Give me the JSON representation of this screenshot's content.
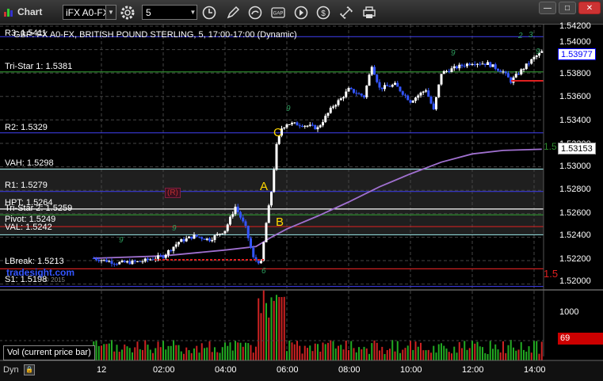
{
  "window": {
    "title": "Chart",
    "symbol": "іFX A0-FX",
    "interval": "5",
    "caption": "GBP: FX A0-FX, BRITISH POUND STERLING, 5, 17:00-17:00 (Dynamic)",
    "watermark": "tradesight.com",
    "watermark_sub": "© 2015"
  },
  "price_axis": {
    "labels": [
      "1.54200",
      "1.54000",
      "1.53800",
      "1.53600",
      "1.53400",
      "1.53200",
      "1.53000",
      "1.52800",
      "1.52600",
      "1.52400",
      "1.52200",
      "1.52000"
    ]
  },
  "price_tags": {
    "last": "1.53977",
    "vwap": "1.53153",
    "red_level": "1.5",
    "green_level": "1.5"
  },
  "levels": [
    {
      "label": "R3: 1.5411",
      "color": "#3a3ad8"
    },
    {
      "label": "Tri-Star 1: 1.5381",
      "color": "#2e8b2e"
    },
    {
      "label": "R2: 1.5329",
      "color": "#3a3ad8"
    },
    {
      "label": "VAH: 1.5298",
      "color": "#8fd6d6"
    },
    {
      "label": "R1: 1.5279",
      "color": "#3a3ad8"
    },
    {
      "label": "HPT: 1.5264",
      "color": "#ffffff"
    },
    {
      "label": "Tri-Star 2: 1.5259",
      "color": "#2e8b2e"
    },
    {
      "label": "Pivot: 1.5249",
      "color": "#cc2222"
    },
    {
      "label": "VAL: 1.5242",
      "color": "#8fd6d6"
    },
    {
      "label": "LBreak: 1.5213",
      "color": "#cc2222"
    },
    {
      "label": "S1: 1.5198",
      "color": "#3a3ad8"
    }
  ],
  "annotations": {
    "point_a": "A",
    "point_b": "B",
    "point_c": "C",
    "r_marker": "(R)"
  },
  "volume": {
    "label": "Vol (current price bar)",
    "axis_label": "1000",
    "current_value": "69"
  },
  "time_axis": {
    "dyn_label": "Dyn",
    "labels": [
      "12",
      "02:00",
      "04:00",
      "06:00",
      "08:00",
      "10:00",
      "12:00",
      "14:00"
    ]
  },
  "colors": {
    "up_bar": "#ffffff",
    "down_bar": "#3355ff",
    "vwap": "#a070d0",
    "volume_up": "#22aa22",
    "volume_down": "#cc2222"
  },
  "chart_data": {
    "type": "candlestick",
    "title": "GBP: FX A0-FX, BRITISH POUND STERLING, 5, 17:00-17:00 (Dynamic)",
    "xlabel": "",
    "ylabel": "",
    "ylim": [
      1.5195,
      1.5425
    ],
    "x_ticks": [
      "12",
      "02:00",
      "04:00",
      "06:00",
      "08:00",
      "10:00",
      "12:00",
      "14:00"
    ],
    "close_path": {
      "x": [
        "23:45",
        "00:30",
        "01:15",
        "02:00",
        "02:30",
        "03:00",
        "03:30",
        "04:00",
        "04:20",
        "04:40",
        "04:55",
        "05:10",
        "05:20",
        "05:30",
        "05:40",
        "05:50",
        "06:00",
        "06:30",
        "07:00",
        "07:30",
        "07:45",
        "08:00",
        "08:30",
        "08:45",
        "09:00",
        "09:30",
        "10:00",
        "10:30",
        "10:45",
        "11:00",
        "11:30",
        "12:00",
        "12:30",
        "13:00",
        "13:15",
        "13:30",
        "14:00",
        "14:15"
      ],
      "y": [
        1.5222,
        1.5218,
        1.5219,
        1.5224,
        1.5236,
        1.5241,
        1.5238,
        1.5246,
        1.5266,
        1.5248,
        1.5222,
        1.5218,
        1.5252,
        1.5279,
        1.5318,
        1.5333,
        1.5337,
        1.5336,
        1.5333,
        1.5352,
        1.5358,
        1.5366,
        1.536,
        1.5387,
        1.5367,
        1.537,
        1.5356,
        1.5366,
        1.5348,
        1.538,
        1.5385,
        1.5389,
        1.5388,
        1.5381,
        1.5373,
        1.538,
        1.5393,
        1.5398
      ]
    },
    "vwap": {
      "x": [
        "23:45",
        "02:00",
        "04:00",
        "05:00",
        "05:30",
        "06:00",
        "07:00",
        "08:00",
        "09:00",
        "10:00",
        "11:00",
        "12:00",
        "13:00",
        "14:15"
      ],
      "y": [
        1.5222,
        1.5224,
        1.5229,
        1.5232,
        1.524,
        1.5247,
        1.5258,
        1.527,
        1.5283,
        1.5294,
        1.5304,
        1.5311,
        1.5314,
        1.5315
      ]
    },
    "levels": {
      "R3": 1.5411,
      "Tri-Star 1": 1.5381,
      "R2": 1.5329,
      "VAH": 1.5298,
      "R1": 1.5279,
      "HPT": 1.5264,
      "Tri-Star 2": 1.5259,
      "Pivot": 1.5249,
      "VAL": 1.5242,
      "LBreak": 1.5213,
      "S1": 1.5198
    },
    "last": 1.53977,
    "vwap_last": 1.53153,
    "volume": {
      "ylabel": "Vol (current price bar)",
      "axis_tick": 1000,
      "current": 69
    }
  }
}
